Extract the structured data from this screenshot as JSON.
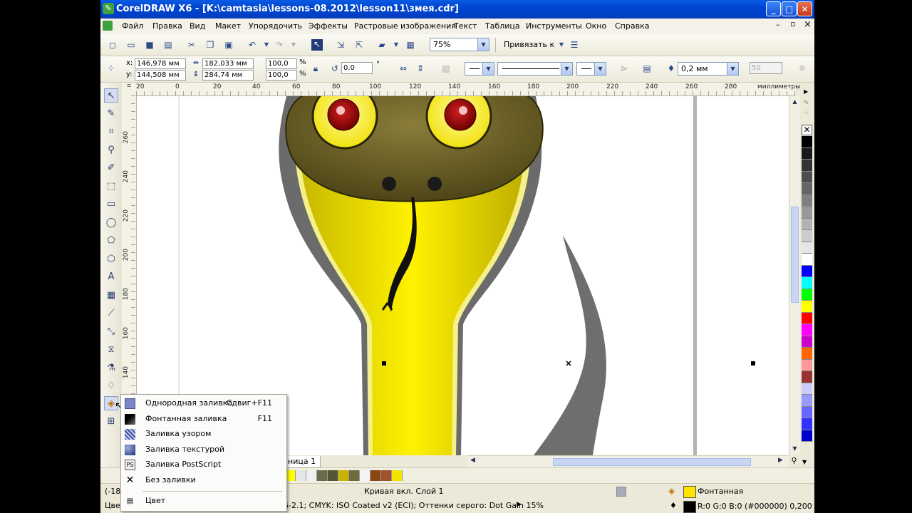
{
  "window": {
    "title": "CorelDRAW X6 - [K:\\camtasia\\lessons-08.2012\\lesson11\\змея.cdr]",
    "min": "_",
    "max": "□",
    "close": "✕"
  },
  "menu": [
    "Файл",
    "Правка",
    "Вид",
    "Макет",
    "Упорядочить",
    "Эффекты",
    "Растровые изображения",
    "Текст",
    "Таблица",
    "Инструменты",
    "Окно",
    "Справка"
  ],
  "menu_controls": {
    "min": "–",
    "restore": "▫",
    "close": "×"
  },
  "toolbar": {
    "zoom": "75%",
    "snap": "Привязать к"
  },
  "props": {
    "x_label": "x:",
    "y_label": "y:",
    "x": "146,978 мм",
    "y": "144,508 мм",
    "w": "182,033 мм",
    "h": "284,74 мм",
    "sx": "100,0",
    "sy": "100,0",
    "pct1": "%",
    "pct2": "%",
    "angle": "0,0",
    "deg": "°",
    "outline_width": "0,2 мм",
    "outline_num": "50"
  },
  "rulers": {
    "units": "миллиметры",
    "h_ticks": [
      "20",
      "0",
      "20",
      "40",
      "60",
      "80",
      "100",
      "120",
      "140",
      "160",
      "180",
      "200",
      "220",
      "240",
      "260",
      "280"
    ],
    "v_ticks": [
      "260",
      "240",
      "220",
      "200",
      "180",
      "160",
      "140"
    ]
  },
  "flyout": {
    "items": [
      {
        "label": "Однородная заливка",
        "shortcut": "Сдвиг+F11"
      },
      {
        "label": "Фонтанная заливка",
        "shortcut": "F11"
      },
      {
        "label": "Заливка узором",
        "shortcut": ""
      },
      {
        "label": "Заливка текстурой",
        "shortcut": ""
      },
      {
        "label": "Заливка PostScript",
        "shortcut": ""
      },
      {
        "label": "Без заливки",
        "shortcut": ""
      },
      {
        "label": "Цвет",
        "shortcut": ""
      }
    ]
  },
  "pagebar": {
    "page_tab": "ница 1"
  },
  "status": {
    "coords": "(-18",
    "object": "Кривая вкл. Слой 1",
    "fill_name": "Фонтанная",
    "profile": "6-2.1; CMYK: ISO Coated v2 (ECI); Оттенки серого: Dot Gain 15%",
    "profile_arrow": "▶",
    "outline": "R:0 G:0 B:0 (#000000)  0,200 мм",
    "left_label": "Цвет"
  },
  "colors": {
    "palette": [
      "#000000",
      "#1a1a1a",
      "#333333",
      "#4d4d4d",
      "#666666",
      "#808080",
      "#999999",
      "#b3b3b3",
      "#cccccc",
      "#e6e6e6",
      "#ffffff",
      "#0000ff",
      "#00ffff",
      "#00ff00",
      "#ffff00",
      "#ff0000",
      "#ff00ff",
      "#cc00cc",
      "#ff6600",
      "#ff9999",
      "#993333",
      "#ccccff",
      "#9999ff",
      "#6666ff",
      "#3333ff",
      "#0000cc"
    ],
    "doc_palette": [
      "#ffff00",
      "#e6e6e6",
      "#f0f0f0",
      "#6b6b4c",
      "#555533",
      "#c8b400",
      "#706a3a",
      "#f4f4f4",
      "#8b4513",
      "#a0522d",
      "#f2e400"
    ]
  }
}
